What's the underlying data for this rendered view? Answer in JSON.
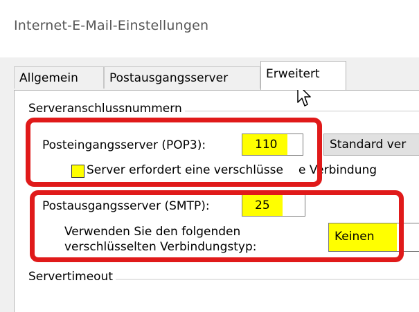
{
  "window": {
    "title": "Internet-E-Mail-Einstellungen"
  },
  "tabs": [
    {
      "label": "Allgemein",
      "active": false
    },
    {
      "label": "Postausgangsserver",
      "active": false
    },
    {
      "label": "Erweitert",
      "active": true
    }
  ],
  "server_ports": {
    "group_label": "Serveranschlussnummern",
    "incoming": {
      "label": "Posteingangsserver (POP3):",
      "value": "110",
      "default_button": "Standard ver"
    },
    "ssl_checkbox": {
      "label_start": "Server erfordert eine verschlüsse",
      "label_end": "e Verbindung",
      "checked": false
    },
    "outgoing": {
      "label": "Postausgangsserver (SMTP):",
      "value": "25"
    },
    "encryption": {
      "label_line1": "Verwenden Sie den folgenden",
      "label_line2": "verschlüsselten Verbindungstyp:",
      "value": "Keinen"
    }
  },
  "timeout": {
    "group_label": "Servertimeout"
  },
  "colors": {
    "highlight": "#ffff00",
    "annotation_red": "#e01a1a"
  }
}
